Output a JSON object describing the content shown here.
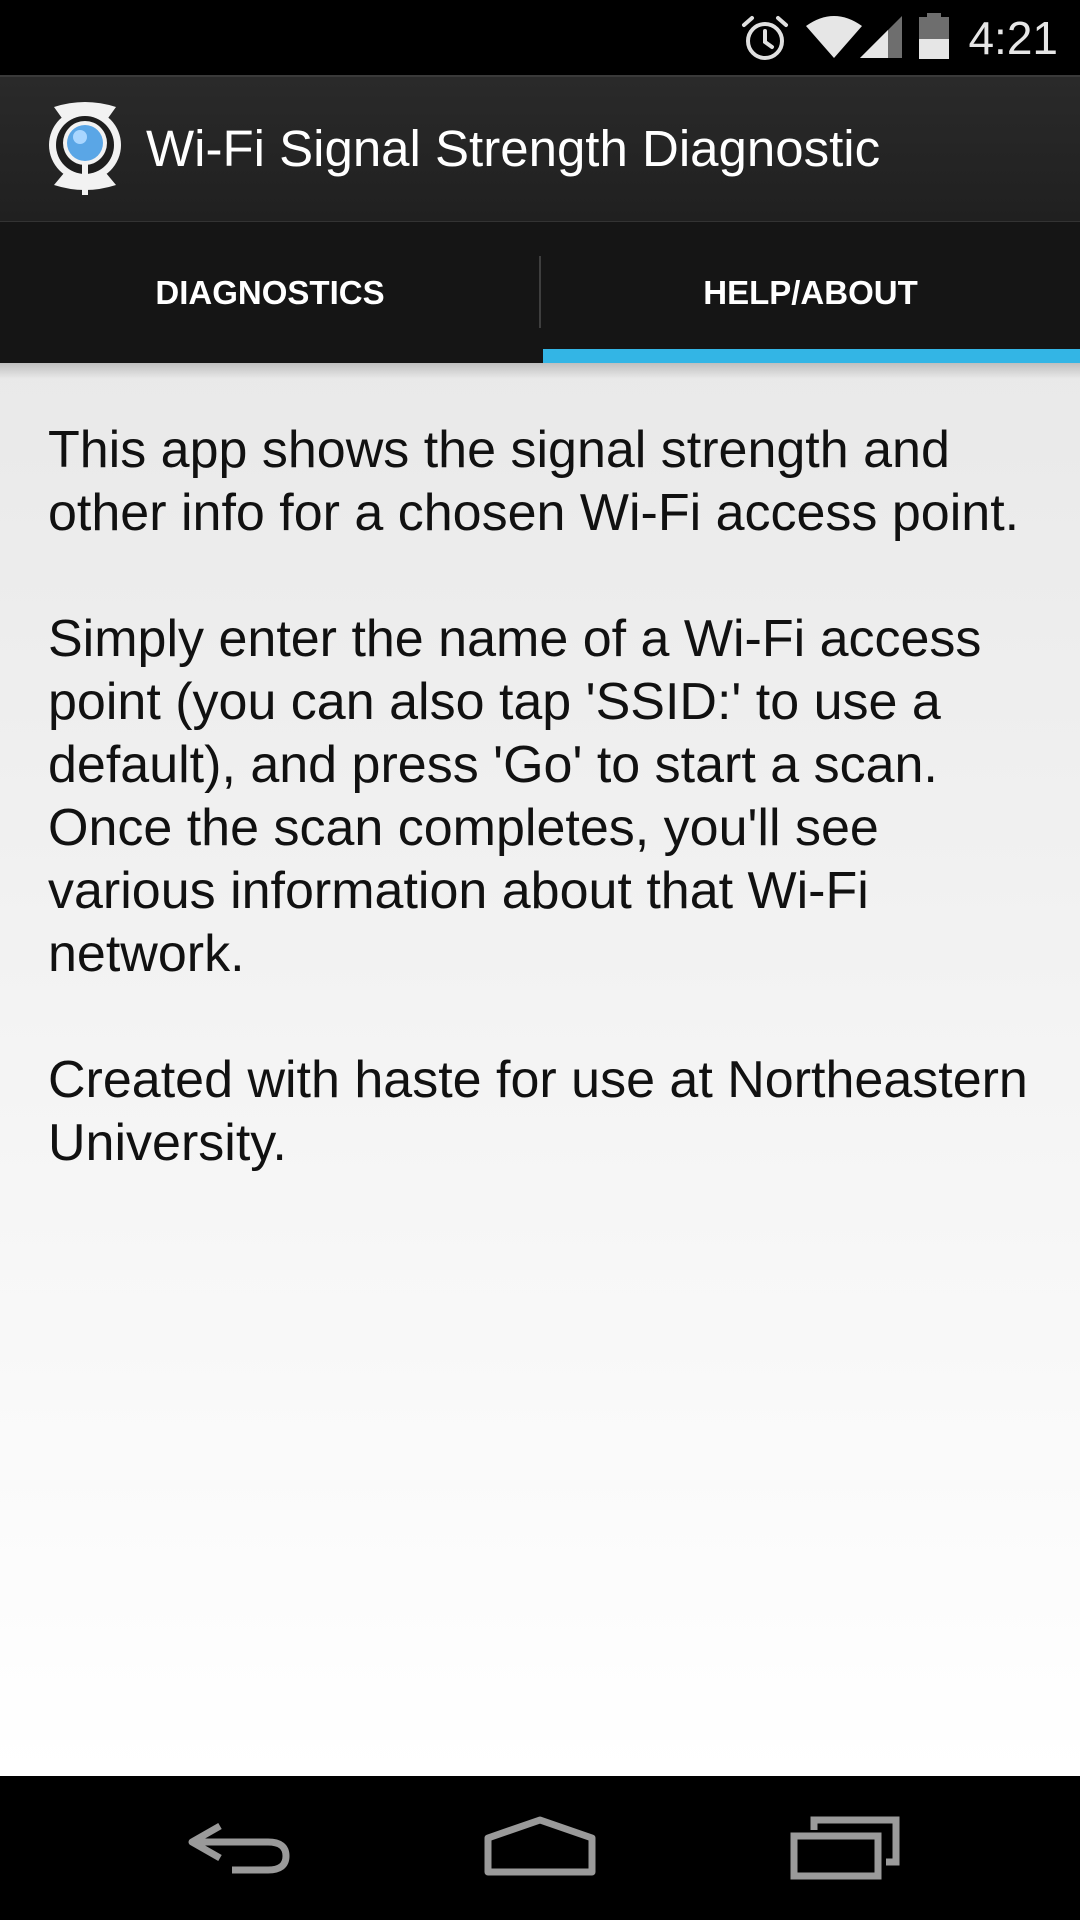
{
  "status_bar": {
    "time": "4:21",
    "icons": [
      "alarm-icon",
      "wifi-icon",
      "cell-signal-icon",
      "battery-icon"
    ]
  },
  "action_bar": {
    "app_icon": "magnifier-signal-icon",
    "title": "Wi-Fi Signal Strength Diagnostic"
  },
  "tabs": [
    {
      "label": "DIAGNOSTICS",
      "selected": false
    },
    {
      "label": "HELP/ABOUT",
      "selected": true
    }
  ],
  "help": {
    "paragraphs": [
      "This app shows the signal strength and other info for a chosen Wi-Fi access point.",
      "Simply enter the name of a Wi-Fi access point (you can also tap 'SSID:' to use a default), and press 'Go' to start a scan. Once the scan completes, you'll see various information about that Wi-Fi network.",
      "Created with haste for use at Northeastern University."
    ]
  },
  "nav_bar": {
    "buttons": [
      "back-icon",
      "home-icon",
      "recents-icon"
    ]
  },
  "colors": {
    "accent": "#33b5e5",
    "status_bar": "#000000",
    "action_bar": "#262626",
    "tab_bar": "#151515",
    "content_background": "#f4f4f4",
    "text": "#111111"
  }
}
